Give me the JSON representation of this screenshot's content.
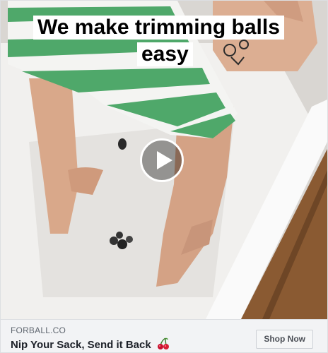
{
  "video": {
    "caption_line1": "We make trimming balls",
    "caption_line2": "easy"
  },
  "footer": {
    "domain": "FORBALL.CO",
    "headline": "Nip Your Sack, Send it Back",
    "headline_icon": "cherries-icon",
    "cta_label": "Shop Now"
  },
  "colors": {
    "stripe_green": "#4fa86a",
    "caption_bg": "#ffffff",
    "footer_bg": "#f2f3f5",
    "floor_wood": "#8a5a32"
  }
}
